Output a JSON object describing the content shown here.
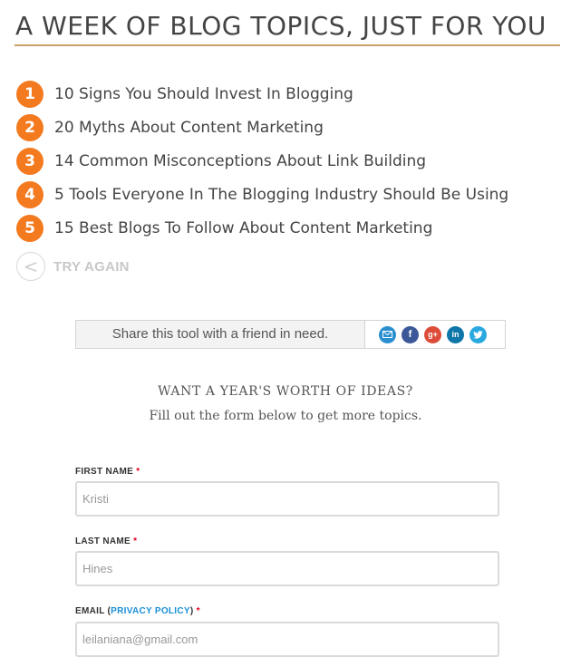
{
  "header": {
    "title": "A WEEK OF BLOG TOPICS, JUST FOR YOU"
  },
  "topics": [
    {
      "number": "1",
      "text": "10 Signs You Should Invest In Blogging"
    },
    {
      "number": "2",
      "text": "20 Myths About Content Marketing"
    },
    {
      "number": "3",
      "text": "14 Common Misconceptions About Link Building"
    },
    {
      "number": "4",
      "text": "5 Tools Everyone In The Blogging Industry Should Be Using"
    },
    {
      "number": "5",
      "text": "15 Best Blogs To Follow About Content Marketing"
    }
  ],
  "try_again": {
    "icon": "<",
    "label": "TRY AGAIN"
  },
  "share": {
    "text": "Share this tool with a friend in need.",
    "icons": [
      "email-icon",
      "facebook-icon",
      "google-plus-icon",
      "linkedin-icon",
      "twitter-icon"
    ]
  },
  "cta": {
    "title": "WANT A YEAR'S WORTH OF IDEAS?",
    "subtitle": "Fill out the form below to get more topics."
  },
  "form": {
    "first_name": {
      "label": "FIRST NAME",
      "required_mark": "*",
      "value": "Kristi"
    },
    "last_name": {
      "label": "LAST NAME",
      "required_mark": "*",
      "value": "Hines"
    },
    "email": {
      "label_prefix": "EMAIL (",
      "link_text": "PRIVACY POLICY",
      "label_suffix": ")",
      "required_mark": "*",
      "value": "leilaniana@gmail.com"
    }
  },
  "colors": {
    "accent_orange": "#f47a20",
    "headline_rule": "#c9a069",
    "link_blue": "#1a8fd6",
    "required_red": "#e0001b"
  }
}
